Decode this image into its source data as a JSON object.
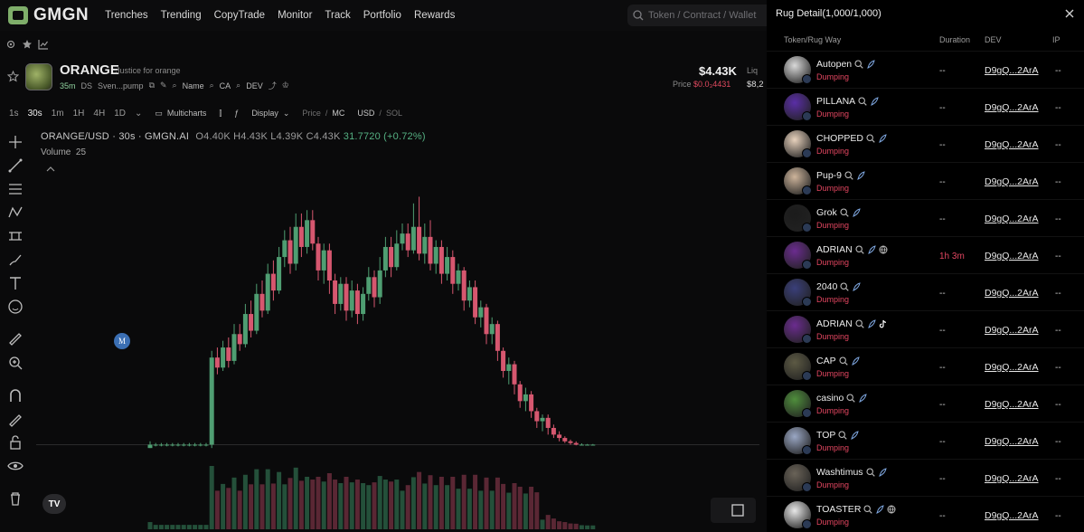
{
  "nav": {
    "logo": "GMGN",
    "items": [
      "Trenches",
      "Trending",
      "CopyTrade",
      "Monitor",
      "Track",
      "Portfolio",
      "Rewards"
    ],
    "search_placeholder": "Token / Contract / Wallet"
  },
  "token": {
    "name": "ORANGE",
    "description": "Justice for orange",
    "age": "35m",
    "ds": "DS",
    "source": "Sven...pump",
    "name_label": "Name",
    "ca_label": "CA",
    "dev_label": "DEV",
    "price_big": "$4.43K",
    "price_label": "Price",
    "price_value": "$0.0₃4431",
    "liq_label": "Liq",
    "liq_value": "$8,2"
  },
  "chart_toolbar": {
    "timeframes": [
      "1s",
      "30s",
      "1m",
      "1H",
      "4H",
      "1D"
    ],
    "active_timeframe": "30s",
    "multicharts": "Multicharts",
    "display": "Display",
    "price_mc_a": "Price",
    "price_mc_b": "MC",
    "usd_sol_a": "USD",
    "usd_sol_b": "SOL"
  },
  "chart": {
    "pair": "ORANGE/USD · 30s · GMGN.AI",
    "ohlc": "O4.40K  H4.43K  L4.39K  C4.43K",
    "change": "31.7720 (+0.72%)",
    "volume_label": "Volume",
    "volume_value": "25",
    "marker": "M",
    "tv": "TV"
  },
  "chart_data": {
    "type": "candlestick",
    "title": "ORANGE/USD · 30s · GMGN.AI",
    "candles": [
      {
        "o": 0.9,
        "c": 1.0,
        "h": 1.1,
        "l": 0.9
      },
      {
        "o": 1.0,
        "c": 1.0,
        "h": 1.05,
        "l": 0.95
      },
      {
        "o": 1.0,
        "c": 1.0,
        "h": 1.05,
        "l": 0.95
      },
      {
        "o": 1.0,
        "c": 1.0,
        "h": 1.05,
        "l": 0.95
      },
      {
        "o": 1.0,
        "c": 1.0,
        "h": 1.05,
        "l": 0.95
      },
      {
        "o": 1.0,
        "c": 1.0,
        "h": 1.05,
        "l": 0.95
      },
      {
        "o": 1.0,
        "c": 1.0,
        "h": 1.05,
        "l": 0.95
      },
      {
        "o": 1.0,
        "c": 1.0,
        "h": 1.05,
        "l": 0.95
      },
      {
        "o": 1.0,
        "c": 1.0,
        "h": 1.05,
        "l": 0.95
      },
      {
        "o": 1.0,
        "c": 1.0,
        "h": 1.05,
        "l": 0.95
      },
      {
        "o": 1.0,
        "c": 1.0,
        "h": 1.05,
        "l": 0.95
      },
      {
        "o": 1.0,
        "c": 3.6,
        "h": 3.8,
        "l": 0.9
      },
      {
        "o": 3.6,
        "c": 3.3,
        "h": 3.9,
        "l": 3.1
      },
      {
        "o": 3.3,
        "c": 3.9,
        "h": 4.1,
        "l": 3.2
      },
      {
        "o": 3.9,
        "c": 3.5,
        "h": 4.2,
        "l": 3.3
      },
      {
        "o": 3.5,
        "c": 4.3,
        "h": 4.6,
        "l": 3.4
      },
      {
        "o": 4.3,
        "c": 4.0,
        "h": 4.6,
        "l": 3.8
      },
      {
        "o": 4.0,
        "c": 4.9,
        "h": 5.2,
        "l": 3.9
      },
      {
        "o": 4.9,
        "c": 4.4,
        "h": 5.3,
        "l": 4.2
      },
      {
        "o": 4.4,
        "c": 5.5,
        "h": 5.8,
        "l": 4.3
      },
      {
        "o": 5.5,
        "c": 5.0,
        "h": 5.9,
        "l": 4.8
      },
      {
        "o": 5.0,
        "c": 6.1,
        "h": 6.4,
        "l": 4.9
      },
      {
        "o": 6.1,
        "c": 5.6,
        "h": 6.5,
        "l": 5.3
      },
      {
        "o": 5.6,
        "c": 6.6,
        "h": 6.9,
        "l": 5.5
      },
      {
        "o": 6.6,
        "c": 7.1,
        "h": 7.4,
        "l": 6.3
      },
      {
        "o": 7.1,
        "c": 6.4,
        "h": 7.5,
        "l": 6.1
      },
      {
        "o": 6.4,
        "c": 7.5,
        "h": 7.9,
        "l": 6.2
      },
      {
        "o": 7.5,
        "c": 6.9,
        "h": 7.9,
        "l": 6.6
      },
      {
        "o": 6.9,
        "c": 7.7,
        "h": 8.0,
        "l": 6.7
      },
      {
        "o": 7.7,
        "c": 7.0,
        "h": 8.0,
        "l": 6.8
      },
      {
        "o": 7.0,
        "c": 6.2,
        "h": 7.2,
        "l": 5.9
      },
      {
        "o": 6.2,
        "c": 6.8,
        "h": 7.0,
        "l": 5.8
      },
      {
        "o": 6.8,
        "c": 5.9,
        "h": 7.0,
        "l": 5.5
      },
      {
        "o": 5.9,
        "c": 5.2,
        "h": 6.1,
        "l": 4.9
      },
      {
        "o": 5.2,
        "c": 5.8,
        "h": 6.0,
        "l": 5.0
      },
      {
        "o": 5.8,
        "c": 5.0,
        "h": 6.0,
        "l": 4.7
      },
      {
        "o": 5.0,
        "c": 5.6,
        "h": 5.9,
        "l": 4.8
      },
      {
        "o": 5.6,
        "c": 4.9,
        "h": 5.8,
        "l": 4.6
      },
      {
        "o": 4.9,
        "c": 5.5,
        "h": 5.7,
        "l": 4.7
      },
      {
        "o": 5.5,
        "c": 6.0,
        "h": 6.3,
        "l": 5.3
      },
      {
        "o": 6.0,
        "c": 5.4,
        "h": 6.2,
        "l": 5.1
      },
      {
        "o": 5.4,
        "c": 6.2,
        "h": 6.6,
        "l": 5.2
      },
      {
        "o": 6.2,
        "c": 6.9,
        "h": 7.2,
        "l": 6.0
      },
      {
        "o": 6.9,
        "c": 6.3,
        "h": 7.2,
        "l": 6.0
      },
      {
        "o": 6.3,
        "c": 7.0,
        "h": 7.4,
        "l": 6.2
      },
      {
        "o": 7.0,
        "c": 7.3,
        "h": 7.6,
        "l": 6.8
      },
      {
        "o": 7.3,
        "c": 6.8,
        "h": 7.6,
        "l": 6.6
      },
      {
        "o": 6.8,
        "c": 7.5,
        "h": 8.2,
        "l": 6.7
      },
      {
        "o": 7.5,
        "c": 6.7,
        "h": 8.4,
        "l": 6.5
      },
      {
        "o": 6.7,
        "c": 7.2,
        "h": 7.6,
        "l": 6.4
      },
      {
        "o": 7.2,
        "c": 6.4,
        "h": 7.7,
        "l": 6.2
      },
      {
        "o": 6.4,
        "c": 6.9,
        "h": 7.1,
        "l": 6.1
      },
      {
        "o": 6.9,
        "c": 6.1,
        "h": 7.1,
        "l": 5.8
      },
      {
        "o": 6.1,
        "c": 6.6,
        "h": 6.9,
        "l": 5.9
      },
      {
        "o": 6.6,
        "c": 5.8,
        "h": 6.8,
        "l": 5.5
      },
      {
        "o": 5.8,
        "c": 6.2,
        "h": 6.4,
        "l": 5.6
      },
      {
        "o": 6.2,
        "c": 5.3,
        "h": 6.3,
        "l": 5.0
      },
      {
        "o": 5.3,
        "c": 5.7,
        "h": 5.9,
        "l": 5.1
      },
      {
        "o": 5.7,
        "c": 4.8,
        "h": 5.9,
        "l": 4.6
      },
      {
        "o": 4.8,
        "c": 5.1,
        "h": 5.3,
        "l": 4.5
      },
      {
        "o": 5.1,
        "c": 4.3,
        "h": 5.2,
        "l": 4.0
      },
      {
        "o": 4.3,
        "c": 4.6,
        "h": 4.8,
        "l": 4.0
      },
      {
        "o": 4.6,
        "c": 3.8,
        "h": 4.7,
        "l": 3.5
      },
      {
        "o": 3.8,
        "c": 3.2,
        "h": 3.9,
        "l": 3.0
      },
      {
        "o": 3.2,
        "c": 3.4,
        "h": 3.6,
        "l": 2.8
      },
      {
        "o": 3.4,
        "c": 2.8,
        "h": 3.5,
        "l": 2.5
      },
      {
        "o": 2.8,
        "c": 2.3,
        "h": 2.9,
        "l": 2.1
      },
      {
        "o": 2.3,
        "c": 2.5,
        "h": 2.7,
        "l": 2.0
      },
      {
        "o": 2.5,
        "c": 2.0,
        "h": 2.6,
        "l": 1.8
      },
      {
        "o": 2.0,
        "c": 1.7,
        "h": 2.1,
        "l": 1.5
      },
      {
        "o": 1.7,
        "c": 1.8,
        "h": 1.9,
        "l": 1.4
      },
      {
        "o": 1.8,
        "c": 1.5,
        "h": 1.9,
        "l": 1.3
      },
      {
        "o": 1.5,
        "c": 1.3,
        "h": 1.6,
        "l": 1.2
      },
      {
        "o": 1.3,
        "c": 1.2,
        "h": 1.4,
        "l": 1.1
      },
      {
        "o": 1.2,
        "c": 1.1,
        "h": 1.25,
        "l": 1.05
      },
      {
        "o": 1.1,
        "c": 1.05,
        "h": 1.15,
        "l": 1.0
      },
      {
        "o": 1.05,
        "c": 1.0,
        "h": 1.1,
        "l": 0.98
      },
      {
        "o": 1.0,
        "c": 1.0,
        "h": 1.04,
        "l": 0.98
      },
      {
        "o": 1.0,
        "c": 1.0,
        "h": 1.02,
        "l": 0.99
      },
      {
        "o": 1.0,
        "c": 1.0,
        "h": 1.02,
        "l": 0.99
      }
    ],
    "colors": {
      "up": "#4f9e72",
      "down": "#d6576f",
      "volume_up": "#24503a",
      "volume_down": "#5a2734"
    }
  },
  "panel": {
    "title": "Rug Detail(1,000/1,000)",
    "headers": {
      "token": "Token/Rug Way",
      "duration": "Duration",
      "dev": "DEV",
      "ip": "IP"
    },
    "rows": [
      {
        "name": "Autopen",
        "status": "Dumping",
        "duration": "--",
        "dev": "D9gQ...2ArA",
        "ip": "--",
        "web": false,
        "tiktok": false,
        "avatar": "#d9d9d9"
      },
      {
        "name": "PILLANA",
        "status": "Dumping",
        "duration": "--",
        "dev": "D9gQ...2ArA",
        "ip": "--",
        "web": false,
        "tiktok": false,
        "avatar": "#5a2ea6"
      },
      {
        "name": "CHOPPED",
        "status": "Dumping",
        "duration": "--",
        "dev": "D9gQ...2ArA",
        "ip": "--",
        "web": false,
        "tiktok": false,
        "avatar": "#e8d2bd"
      },
      {
        "name": "Pup-9",
        "status": "Dumping",
        "duration": "--",
        "dev": "D9gQ...2ArA",
        "ip": "--",
        "web": false,
        "tiktok": false,
        "avatar": "#cdb49b"
      },
      {
        "name": "Grok",
        "status": "Dumping",
        "duration": "--",
        "dev": "D9gQ...2ArA",
        "ip": "--",
        "web": false,
        "tiktok": false,
        "avatar": "#1b1b1b"
      },
      {
        "name": "ADRIAN",
        "status": "Dumping",
        "duration": "1h 3m",
        "dev": "D9gQ...2ArA",
        "ip": "--",
        "web": true,
        "tiktok": false,
        "avatar": "#6b2c8f"
      },
      {
        "name": "2040",
        "status": "Dumping",
        "duration": "--",
        "dev": "D9gQ...2ArA",
        "ip": "--",
        "web": false,
        "tiktok": false,
        "avatar": "#3a3f7a"
      },
      {
        "name": "ADRIAN",
        "status": "Dumping",
        "duration": "--",
        "dev": "D9gQ...2ArA",
        "ip": "--",
        "web": false,
        "tiktok": true,
        "avatar": "#6b2c8f"
      },
      {
        "name": "CAP",
        "status": "Dumping",
        "duration": "--",
        "dev": "D9gQ...2ArA",
        "ip": "--",
        "web": false,
        "tiktok": false,
        "avatar": "#5d5a44"
      },
      {
        "name": "casino",
        "status": "Dumping",
        "duration": "--",
        "dev": "D9gQ...2ArA",
        "ip": "--",
        "web": false,
        "tiktok": false,
        "avatar": "#4f8e3c"
      },
      {
        "name": "TOP",
        "status": "Dumping",
        "duration": "--",
        "dev": "D9gQ...2ArA",
        "ip": "--",
        "web": false,
        "tiktok": false,
        "avatar": "#9aa7c4"
      },
      {
        "name": "Washtimus",
        "status": "Dumping",
        "duration": "--",
        "dev": "D9gQ...2ArA",
        "ip": "--",
        "web": false,
        "tiktok": false,
        "avatar": "#6a6358"
      },
      {
        "name": "TOASTER",
        "status": "Dumping",
        "duration": "--",
        "dev": "D9gQ...2ArA",
        "ip": "--",
        "web": true,
        "tiktok": false,
        "avatar": "#e8e8e8"
      }
    ]
  }
}
